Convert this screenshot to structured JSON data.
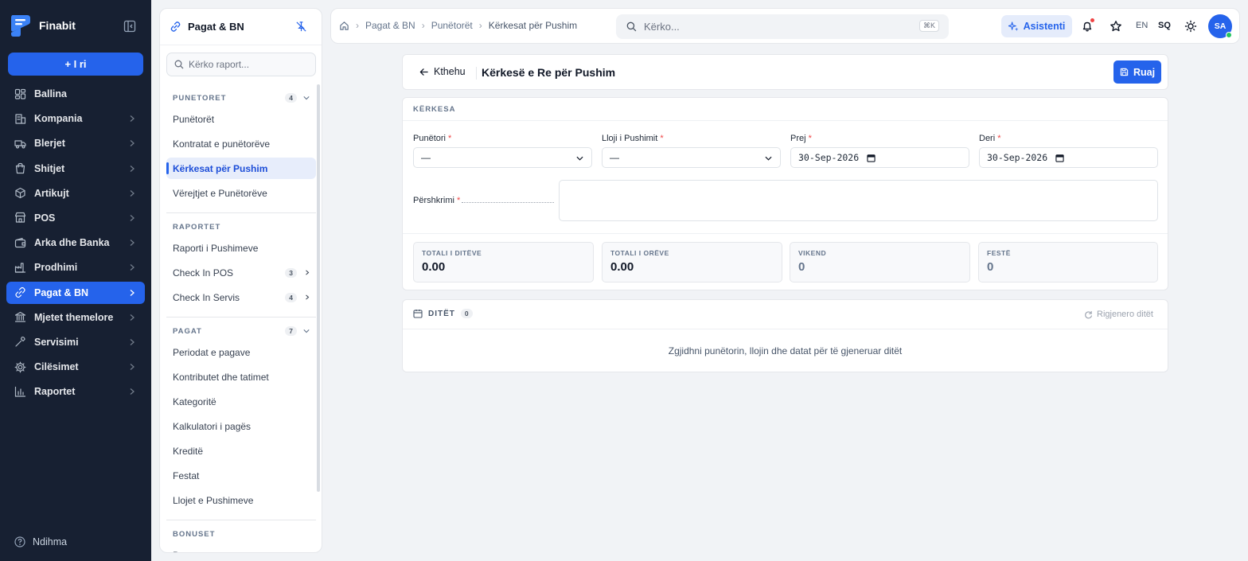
{
  "app": {
    "name": "Finabit",
    "new_label": "+ I ri",
    "help_label": "Ndihma"
  },
  "sidebar": {
    "items": [
      {
        "label": "Ballina",
        "icon": "dashboard-icon",
        "has_children": false
      },
      {
        "label": "Kompania",
        "icon": "building-icon",
        "has_children": true
      },
      {
        "label": "Blerjet",
        "icon": "truck-icon",
        "has_children": true
      },
      {
        "label": "Shitjet",
        "icon": "shopping-bag-icon",
        "has_children": true
      },
      {
        "label": "Artikujt",
        "icon": "box-icon",
        "has_children": true
      },
      {
        "label": "POS",
        "icon": "store-icon",
        "has_children": true
      },
      {
        "label": "Arka dhe Banka",
        "icon": "wallet-icon",
        "has_children": true
      },
      {
        "label": "Prodhimi",
        "icon": "factory-icon",
        "has_children": true
      },
      {
        "label": "Pagat & BN",
        "icon": "link-icon",
        "has_children": true,
        "active": true
      },
      {
        "label": "Mjetet themelore",
        "icon": "bank-icon",
        "has_children": true
      },
      {
        "label": "Servisimi",
        "icon": "wrench-icon",
        "has_children": true
      },
      {
        "label": "Cilësimet",
        "icon": "gear-icon",
        "has_children": true
      },
      {
        "label": "Raportet",
        "icon": "bar-chart-icon",
        "has_children": true
      }
    ]
  },
  "subpanel": {
    "title": "Pagat & BN",
    "search_placeholder": "Kërko raport...",
    "sections": [
      {
        "title": "PUNETORET",
        "count": "4",
        "items": [
          {
            "label": "Punëtorët"
          },
          {
            "label": "Kontratat e punëtorëve"
          },
          {
            "label": "Kërkesat për Pushim",
            "active": true
          },
          {
            "label": "Vërejtjet e Punëtorëve"
          }
        ]
      },
      {
        "title": "RAPORTET",
        "count": "",
        "items": [
          {
            "label": "Raporti i Pushimeve"
          },
          {
            "label": "Check In POS",
            "count": "3"
          },
          {
            "label": "Check In Servis",
            "count": "4"
          }
        ]
      },
      {
        "title": "PAGAT",
        "count": "7",
        "items": [
          {
            "label": "Periodat e pagave"
          },
          {
            "label": "Kontributet dhe tatimet"
          },
          {
            "label": "Kategoritë"
          },
          {
            "label": "Kalkulatori i pagës"
          },
          {
            "label": "Kreditë"
          },
          {
            "label": "Festat"
          },
          {
            "label": "Llojet e Pushimeve"
          }
        ]
      },
      {
        "title": "BONUSET",
        "count": "",
        "items": [
          {
            "label": "Bonuset"
          }
        ]
      }
    ]
  },
  "topbar": {
    "breadcrumbs": [
      "Pagat & BN",
      "Punëtorët",
      "Kërkesat për Pushim"
    ],
    "search_placeholder": "Kërko...",
    "search_shortcut": "⌘K",
    "assistant_label": "Asistenti",
    "lang_en": "EN",
    "lang_sq": "SQ",
    "avatar_initials": "SA"
  },
  "page": {
    "back_label": "Kthehu",
    "title": "Kërkesë e Re për Pushim",
    "save_label": "Ruaj"
  },
  "form": {
    "section_label": "KËRKESA",
    "employee": {
      "label": "Punëtori",
      "value": "—"
    },
    "leave_type": {
      "label": "Lloji i Pushimit",
      "value": "—"
    },
    "from": {
      "label": "Prej",
      "value": "30-Sep-2026"
    },
    "to": {
      "label": "Deri",
      "value": "30-Sep-2026"
    },
    "description": {
      "label": "Përshkrimi",
      "value": ""
    },
    "stats": [
      {
        "label": "TOTALI I DITËVE",
        "value": "0.00"
      },
      {
        "label": "TOTALI I ORËVE",
        "value": "0.00"
      },
      {
        "label": "VIKEND",
        "value": "0"
      },
      {
        "label": "FESTË",
        "value": "0"
      }
    ]
  },
  "days": {
    "title": "DITËT",
    "count": "0",
    "regenerate_label": "Rigjenero ditët",
    "empty_text": "Zgjidhni punëtorin, llojin dhe datat për të gjeneruar ditët"
  },
  "colors": {
    "primary": "#2563eb",
    "sidebar_bg": "#172032",
    "required": "#ef4444",
    "online": "#22c55e"
  }
}
